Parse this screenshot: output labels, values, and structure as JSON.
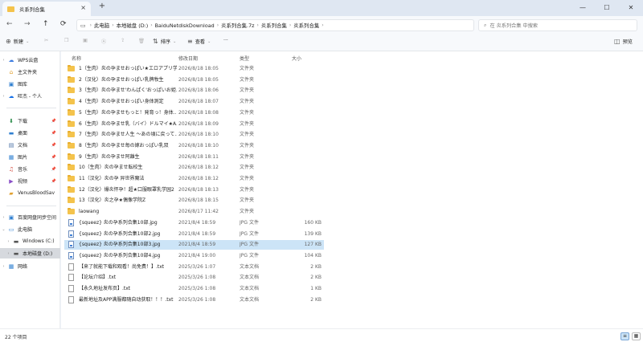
{
  "tab": {
    "title": "炎系列合集"
  },
  "window": {
    "minimize": "—",
    "maximize": "☐",
    "close": "✕"
  },
  "nav": {
    "back": "←",
    "forward": "→",
    "up": "↑",
    "refresh": "⟳"
  },
  "breadcrumbs": [
    "此电脑",
    "本地磁盘 (D:)",
    "BaiduNetdiskDownload",
    "炎系列合集.7z",
    "炎系列合集",
    "炎系列合集"
  ],
  "search": {
    "placeholder": "在 炎系列合集 中搜索"
  },
  "toolbar": {
    "new_label": "新建",
    "sort_label": "排序",
    "view_label": "查看",
    "more_label": "···",
    "preview_label": "预览"
  },
  "sidebar": {
    "items": [
      {
        "label": "WPS云盘",
        "icon": "cloud-icon"
      },
      {
        "label": "主文件夹",
        "icon": "home-icon"
      },
      {
        "label": "图库",
        "icon": "gallery-icon"
      },
      {
        "label": "旺杰 - 个人",
        "icon": "onedrive-icon"
      },
      {
        "label": "下载",
        "icon": "download-icon"
      },
      {
        "label": "桌面",
        "icon": "desktop-icon"
      },
      {
        "label": "文档",
        "icon": "document-icon"
      },
      {
        "label": "图片",
        "icon": "picture-icon"
      },
      {
        "label": "音乐",
        "icon": "music-icon"
      },
      {
        "label": "视频",
        "icon": "video-icon"
      },
      {
        "label": "VenusBloodSav",
        "icon": "folder-icon"
      },
      {
        "label": "百度网盘同步空间",
        "icon": "baidu-icon"
      },
      {
        "label": "此电脑",
        "icon": "computer-icon"
      },
      {
        "label": "Windows (C:)",
        "icon": "drive-icon"
      },
      {
        "label": "本地磁盘 (D:)",
        "icon": "drive-icon"
      },
      {
        "label": "网络",
        "icon": "network-icon"
      }
    ]
  },
  "columns": {
    "name": "名称",
    "date": "修改日期",
    "type": "类型",
    "size": "大小"
  },
  "files": [
    {
      "name": "1（生肉）炎の孕ませおっぱい★エロアプリ学園",
      "date": "2026/8/18 18:05",
      "type": "文件夹",
      "size": "",
      "kind": "folder"
    },
    {
      "name": "2（汉化）炎の孕ませおっぱい乳牌牧生",
      "date": "2026/8/18 18:05",
      "type": "文件夹",
      "size": "",
      "kind": "folder"
    },
    {
      "name": "3（生肉）炎の孕ませ'わんぱく'おっぱいお姫...",
      "date": "2026/8/18 18:06",
      "type": "文件夹",
      "size": "",
      "kind": "folder"
    },
    {
      "name": "4（生肉）炎の孕ませおっぱい身体測定",
      "date": "2026/8/18 18:07",
      "type": "文件夹",
      "size": "",
      "kind": "folder"
    },
    {
      "name": "5（生肉）炎の孕ませもっと！発育っ！身体...",
      "date": "2026/8/18 18:08",
      "type": "文件夹",
      "size": "",
      "kind": "folder"
    },
    {
      "name": "6（生肉）炎の孕ませ乳（バイ）ドルマイ★A...",
      "date": "2026/8/18 18:09",
      "type": "文件夹",
      "size": "",
      "kind": "folder"
    },
    {
      "name": "7（生肉）炎の孕ませ人生 ～あの頃に戻って...",
      "date": "2026/8/18 18:10",
      "type": "文件夹",
      "size": "",
      "kind": "folder"
    },
    {
      "name": "8（生肉）炎の孕ませ毎の嫁おっぱい乳双",
      "date": "2026/8/18 18:10",
      "type": "文件夹",
      "size": "",
      "kind": "folder"
    },
    {
      "name": "9（生肉）炎の孕ませ阿離生",
      "date": "2026/8/18 18:11",
      "type": "文件夹",
      "size": "",
      "kind": "folder"
    },
    {
      "name": "10（生肉）炎の孕ませ転校生",
      "date": "2026/8/18 18:12",
      "type": "文件夹",
      "size": "",
      "kind": "folder"
    },
    {
      "name": "11（汉化）炎の孕 异世界魔法",
      "date": "2026/8/18 18:12",
      "type": "文件夹",
      "size": "",
      "kind": "folder"
    },
    {
      "name": "12（汉化）爆炎怀孕！超★口服眼罩乳学园2",
      "date": "2026/8/18 18:13",
      "type": "文件夹",
      "size": "",
      "kind": "folder"
    },
    {
      "name": "13（汉化）炎之孕★偶像学院Z",
      "date": "2026/8/18 18:15",
      "type": "文件夹",
      "size": "",
      "kind": "folder"
    },
    {
      "name": "laowang",
      "date": "2026/8/17 11:42",
      "type": "文件夹",
      "size": "",
      "kind": "folder"
    },
    {
      "name": "{squeez} 炎の孕系列合集10部.jpg",
      "date": "2021/8/4 18:59",
      "type": "JPG 文件",
      "size": "160 KB",
      "kind": "image"
    },
    {
      "name": "{squeez} 炎の孕系列合集10部2.jpg",
      "date": "2021/8/4 18:59",
      "type": "JPG 文件",
      "size": "139 KB",
      "kind": "image"
    },
    {
      "name": "{squeez} 炎の孕系列合集10部3.jpg",
      "date": "2021/8/4 18:59",
      "type": "JPG 文件",
      "size": "127 KB",
      "kind": "image"
    },
    {
      "name": "{squeez} 炎の孕系列合集10部4.jpg",
      "date": "2021/8/4 19:00",
      "type": "JPG 文件",
      "size": "104 KB",
      "kind": "image"
    },
    {
      "name": "【来了就能下载和观看！尚免费！】.txt",
      "date": "2025/3/26 1:07",
      "type": "文本文档",
      "size": "2 KB",
      "kind": "text"
    },
    {
      "name": "【论坛介绍】.txt",
      "date": "2025/3/26 1:08",
      "type": "文本文档",
      "size": "2 KB",
      "kind": "text"
    },
    {
      "name": "【永久地址发布页】.txt",
      "date": "2025/3/26 1:08",
      "type": "文本文档",
      "size": "1 KB",
      "kind": "text"
    },
    {
      "name": "最新地址及APP满服都随自动获取！！！.txt",
      "date": "2025/3/26 1:08",
      "type": "文本文档",
      "size": "2 KB",
      "kind": "text"
    }
  ],
  "selected_index": 16,
  "status": {
    "count": "22 个项目"
  }
}
